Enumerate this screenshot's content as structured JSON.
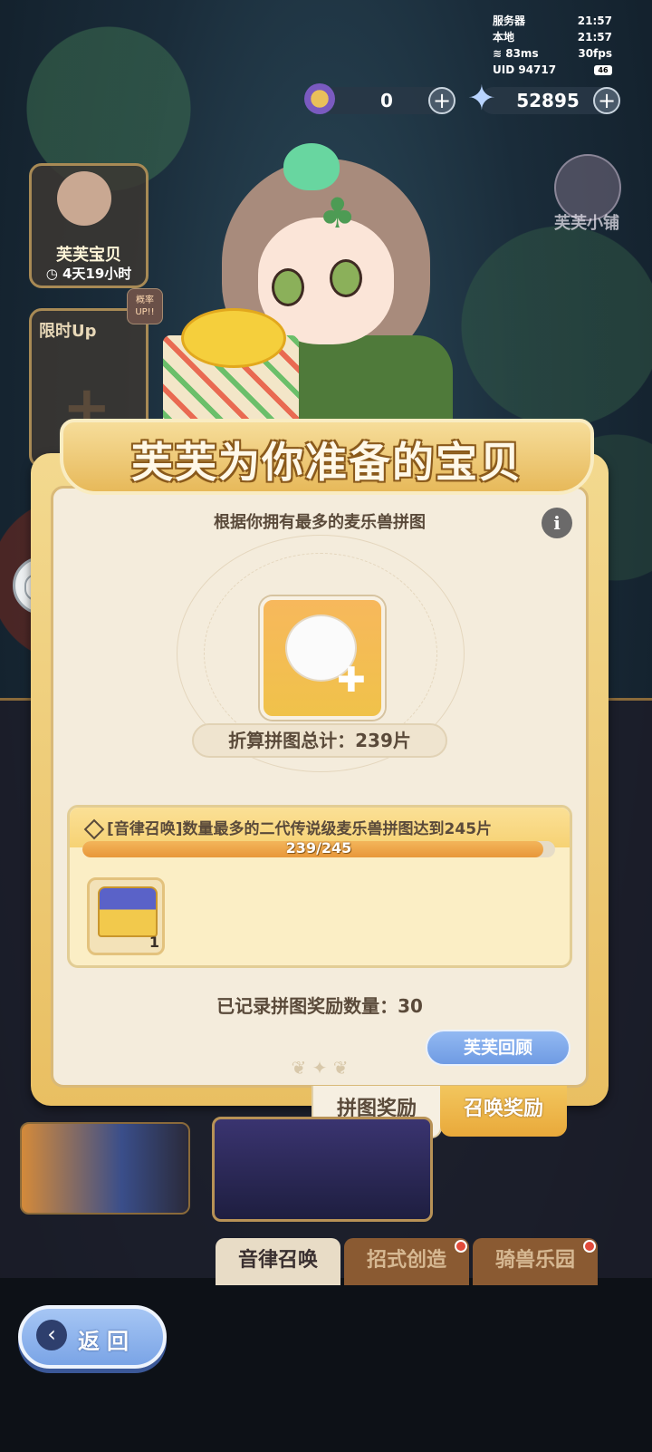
{
  "status": {
    "server_label": "服务器",
    "server_time": "21:57",
    "local_label": "本地",
    "local_time": "21:57",
    "ping": "83ms",
    "fps": "30fps",
    "uid_label": "UID",
    "uid": "94717",
    "battery": "46"
  },
  "currency": {
    "bells": "0",
    "stars": "52895"
  },
  "side": {
    "card1_title": "芙芙宝贝",
    "card1_timer": "4天19小时",
    "card2_title": "限时Up",
    "card2_badge": "概率UP!!",
    "card2_plus": "+",
    "shop_label": "芙芙小铺"
  },
  "dialog": {
    "title": "芙芙为你准备的宝贝",
    "subtitle": "根据你拥有最多的麦乐兽拼图",
    "info": "i",
    "total_label": "折算拼图总计：239片",
    "task_text": "[音律召唤]数量最多的二代传说级麦乐兽拼图达到245片",
    "progress_text": "239/245",
    "progress_fraction": 0.9755,
    "reward_count": "1",
    "recorded_label": "已记录拼图奖励数量：30",
    "review_button": "芙芙回顾",
    "tab_puzzle": "拼图奖励",
    "tab_summon": "召唤奖励"
  },
  "nav": {
    "tab1": "音律召唤",
    "tab2": "招式创造",
    "tab3": "骑兽乐园"
  },
  "back": {
    "label": "返回"
  },
  "colors": {
    "accent_gold": "#e9bf62",
    "panel_bg": "#f4ecdc",
    "progress_fill": "#e8973a",
    "button_blue": "#7aa4e6"
  }
}
